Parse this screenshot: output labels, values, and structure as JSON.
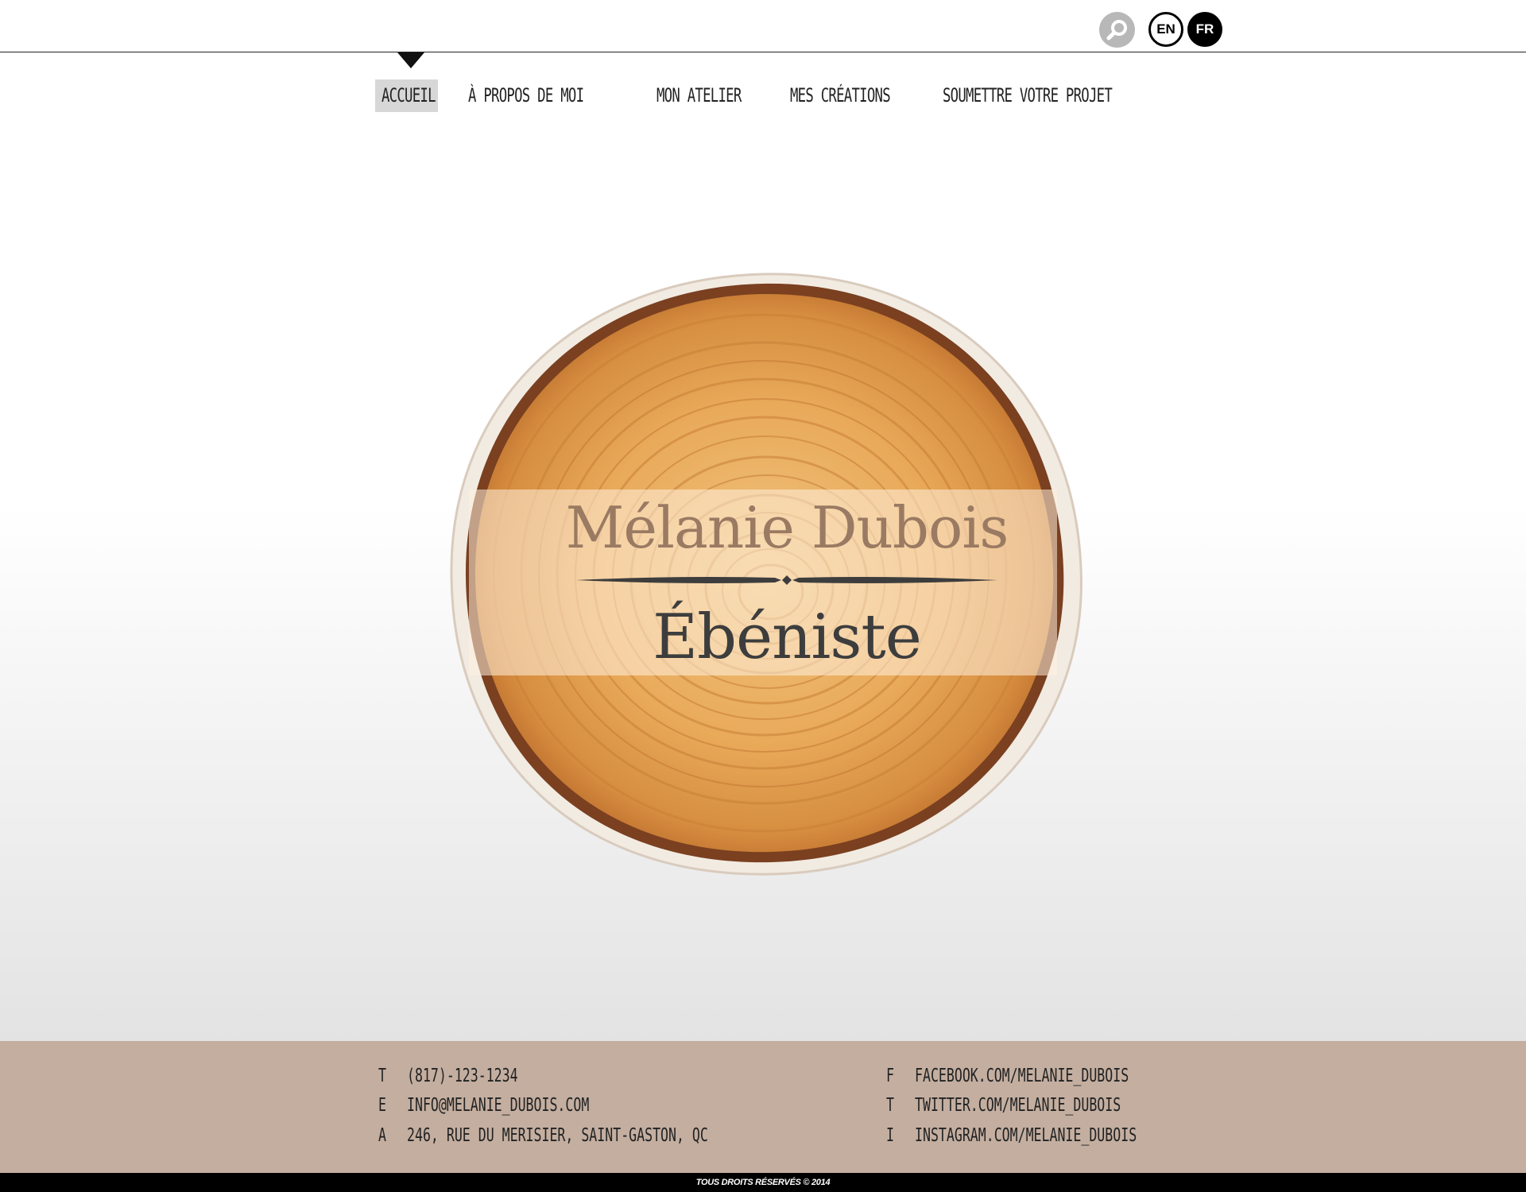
{
  "header": {
    "search_icon": "search-icon",
    "languages": [
      {
        "code": "EN",
        "active": false
      },
      {
        "code": "FR",
        "active": true
      }
    ]
  },
  "nav": {
    "items": [
      {
        "label": "Accueil",
        "active": true
      },
      {
        "label": "À propos de moi",
        "active": false
      },
      {
        "label": "Mon atelier",
        "active": false
      },
      {
        "label": "Mes créations",
        "active": false
      },
      {
        "label": "Soumettre votre projet",
        "active": false
      }
    ]
  },
  "hero": {
    "name": "Mélanie Dubois",
    "profession": "Ébéniste"
  },
  "footer": {
    "contacts_left": [
      {
        "key": "T",
        "value": "(817)-123-1234"
      },
      {
        "key": "E",
        "value": "info@melanie_dubois.com"
      },
      {
        "key": "A",
        "value": "246, rue du Merisier, Saint-Gaston, QC"
      }
    ],
    "contacts_right": [
      {
        "key": "F",
        "value": "facebook.com/melanie_dubois"
      },
      {
        "key": "T",
        "value": "twitter.com/melanie_dubois"
      },
      {
        "key": "I",
        "value": "instagram.com/melanie_dubois"
      }
    ],
    "copyright": "TOUS DROITS RÉSERVÉS © 2014"
  },
  "colors": {
    "footer_bg": "#c3aea0",
    "name_color": "#9a7a62",
    "profession_color": "#3d3d3d",
    "active_nav_bg": "#d7d7d7"
  }
}
